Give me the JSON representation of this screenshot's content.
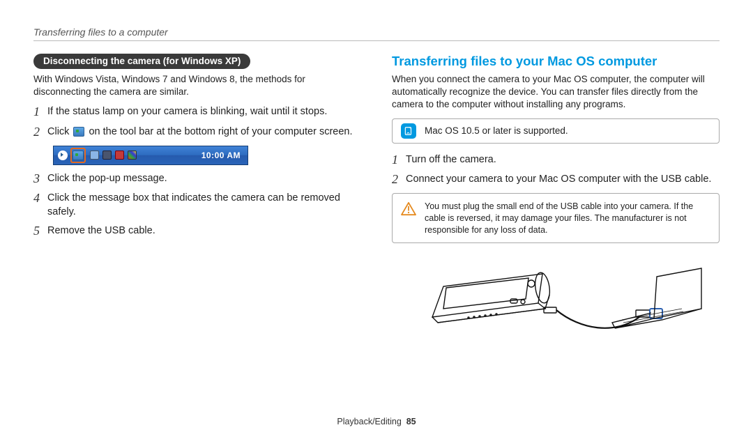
{
  "running_head": "Transferring files to a computer",
  "left": {
    "pill": "Disconnecting the camera (for Windows XP)",
    "intro": "With Windows Vista, Windows 7 and Windows 8, the methods for disconnecting the camera are similar.",
    "steps": {
      "s1": "If the status lamp on your camera is blinking, wait until it stops.",
      "s2a": "Click",
      "s2b": "on the tool bar at the bottom right of your computer screen.",
      "s3": "Click the pop-up message.",
      "s4": "Click the message box that indicates the camera can be removed safely.",
      "s5": "Remove the USB cable."
    },
    "taskbar_clock": "10:00 AM"
  },
  "right": {
    "title": "Transferring files to your Mac OS computer",
    "intro": "When you connect the camera to your Mac OS computer, the computer will automatically recognize the device. You can transfer files directly from the camera to the computer without installing any programs.",
    "info_note": "Mac OS 10.5 or later is supported.",
    "steps": {
      "s1": "Turn off the camera.",
      "s2": "Connect your camera to your Mac OS computer with the USB cable."
    },
    "warning": "You must plug the small end of the USB cable into your camera. If the cable is reversed, it may damage your files. The manufacturer is not responsible for any loss of data."
  },
  "footer": {
    "section": "Playback/Editing",
    "page": "85"
  }
}
